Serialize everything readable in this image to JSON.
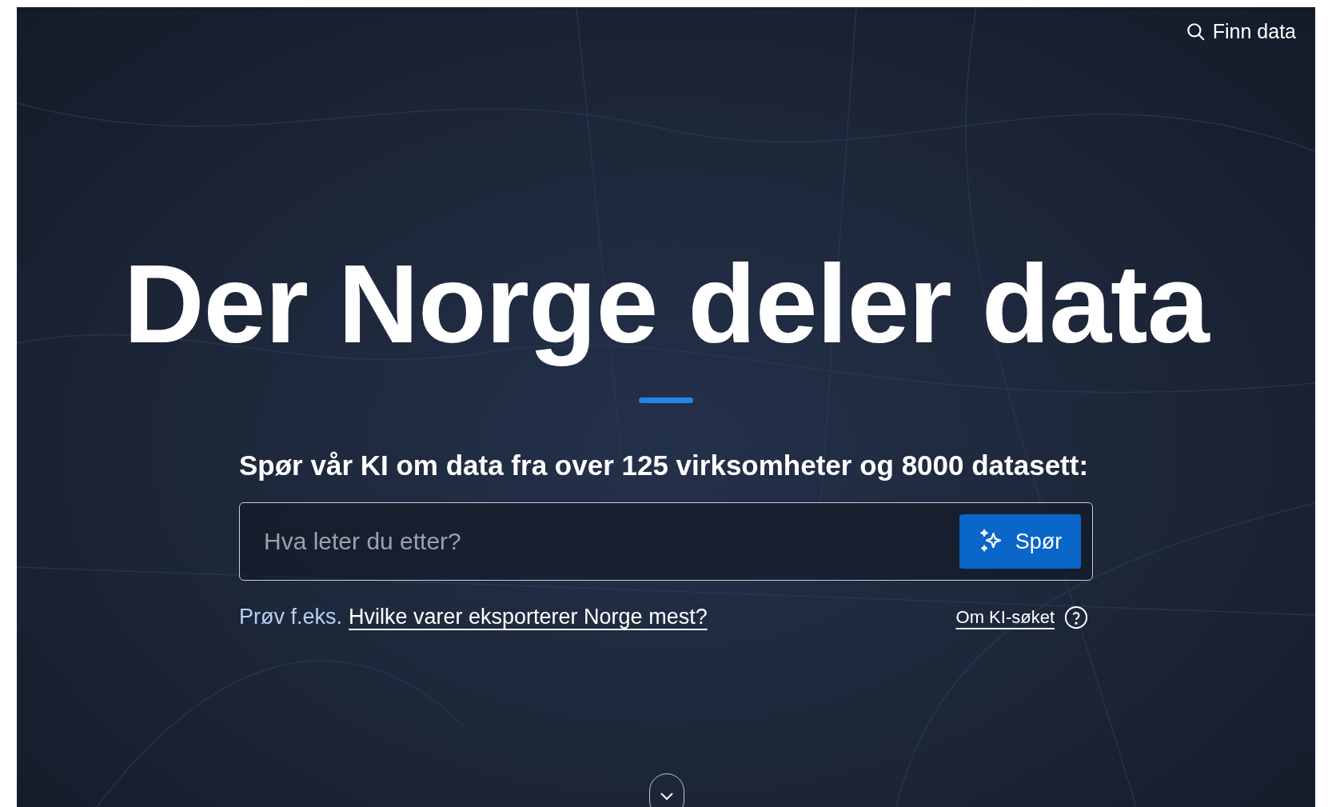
{
  "header": {
    "search_link": "Finn data"
  },
  "hero": {
    "title": "Der Norge deler data",
    "subtitle": "Spør vår KI om data fra over 125 virksomheter og 8000 datasett:",
    "search": {
      "placeholder": "Hva leter du etter?",
      "button": "Spør"
    },
    "example": {
      "prefix": "Prøv f.eks.",
      "link": "Hvilke varer eksporterer Norge mest?"
    },
    "about_link": "Om KI-søket"
  }
}
